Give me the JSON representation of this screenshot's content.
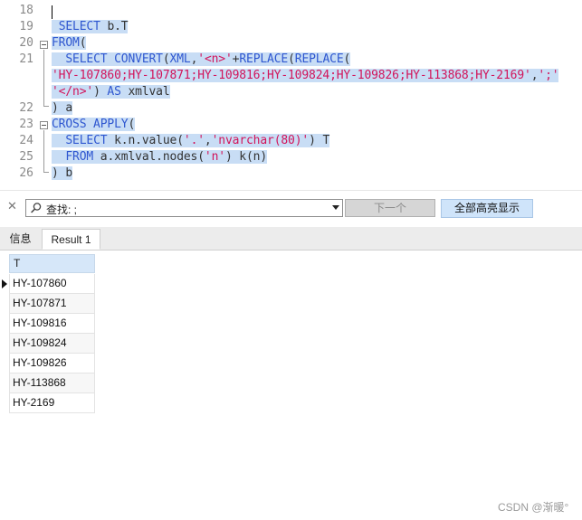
{
  "editor": {
    "lines": [
      {
        "num": "18",
        "text": ""
      },
      {
        "num": "19",
        "text": " SELECT b.T"
      },
      {
        "num": "20",
        "text": "FROM("
      },
      {
        "num": "21",
        "text": "  SELECT CONVERT(XML,'<n>'+REPLACE(REPLACE("
      },
      {
        "num": "",
        "text": "'HY-107860;HY-107871;HY-109816;HY-109824;HY-109826;HY-113868;HY-2169',';'"
      },
      {
        "num": "",
        "text": "'</n>') AS xmlval"
      },
      {
        "num": "22",
        "text": ") a"
      },
      {
        "num": "23",
        "text": "CROSS APPLY("
      },
      {
        "num": "24",
        "text": "  SELECT k.n.value('.','nvarchar(80)') T"
      },
      {
        "num": "25",
        "text": "  FROM a.xmlval.nodes('n') k(n)"
      },
      {
        "num": "26",
        "text": ") b"
      }
    ]
  },
  "search": {
    "close_icon": "close-icon",
    "label": "查找: ;",
    "next_label": "下一个",
    "highlight_all_label": "全部高亮显示"
  },
  "tabs": [
    {
      "label": "信息",
      "active": false
    },
    {
      "label": "Result 1",
      "active": true
    }
  ],
  "grid": {
    "column": "T",
    "rows": [
      "HY-107860",
      "HY-107871",
      "HY-109816",
      "HY-109824",
      "HY-109826",
      "HY-113868",
      "HY-2169"
    ],
    "current_row": 0
  },
  "watermark": "CSDN @渐暖°",
  "colors": {
    "selection": "#c8ddf5",
    "keyword": "#2f57d0",
    "string": "#d2145a",
    "header": "#d6e7f9",
    "highlight_button": "#cfe4fa"
  }
}
